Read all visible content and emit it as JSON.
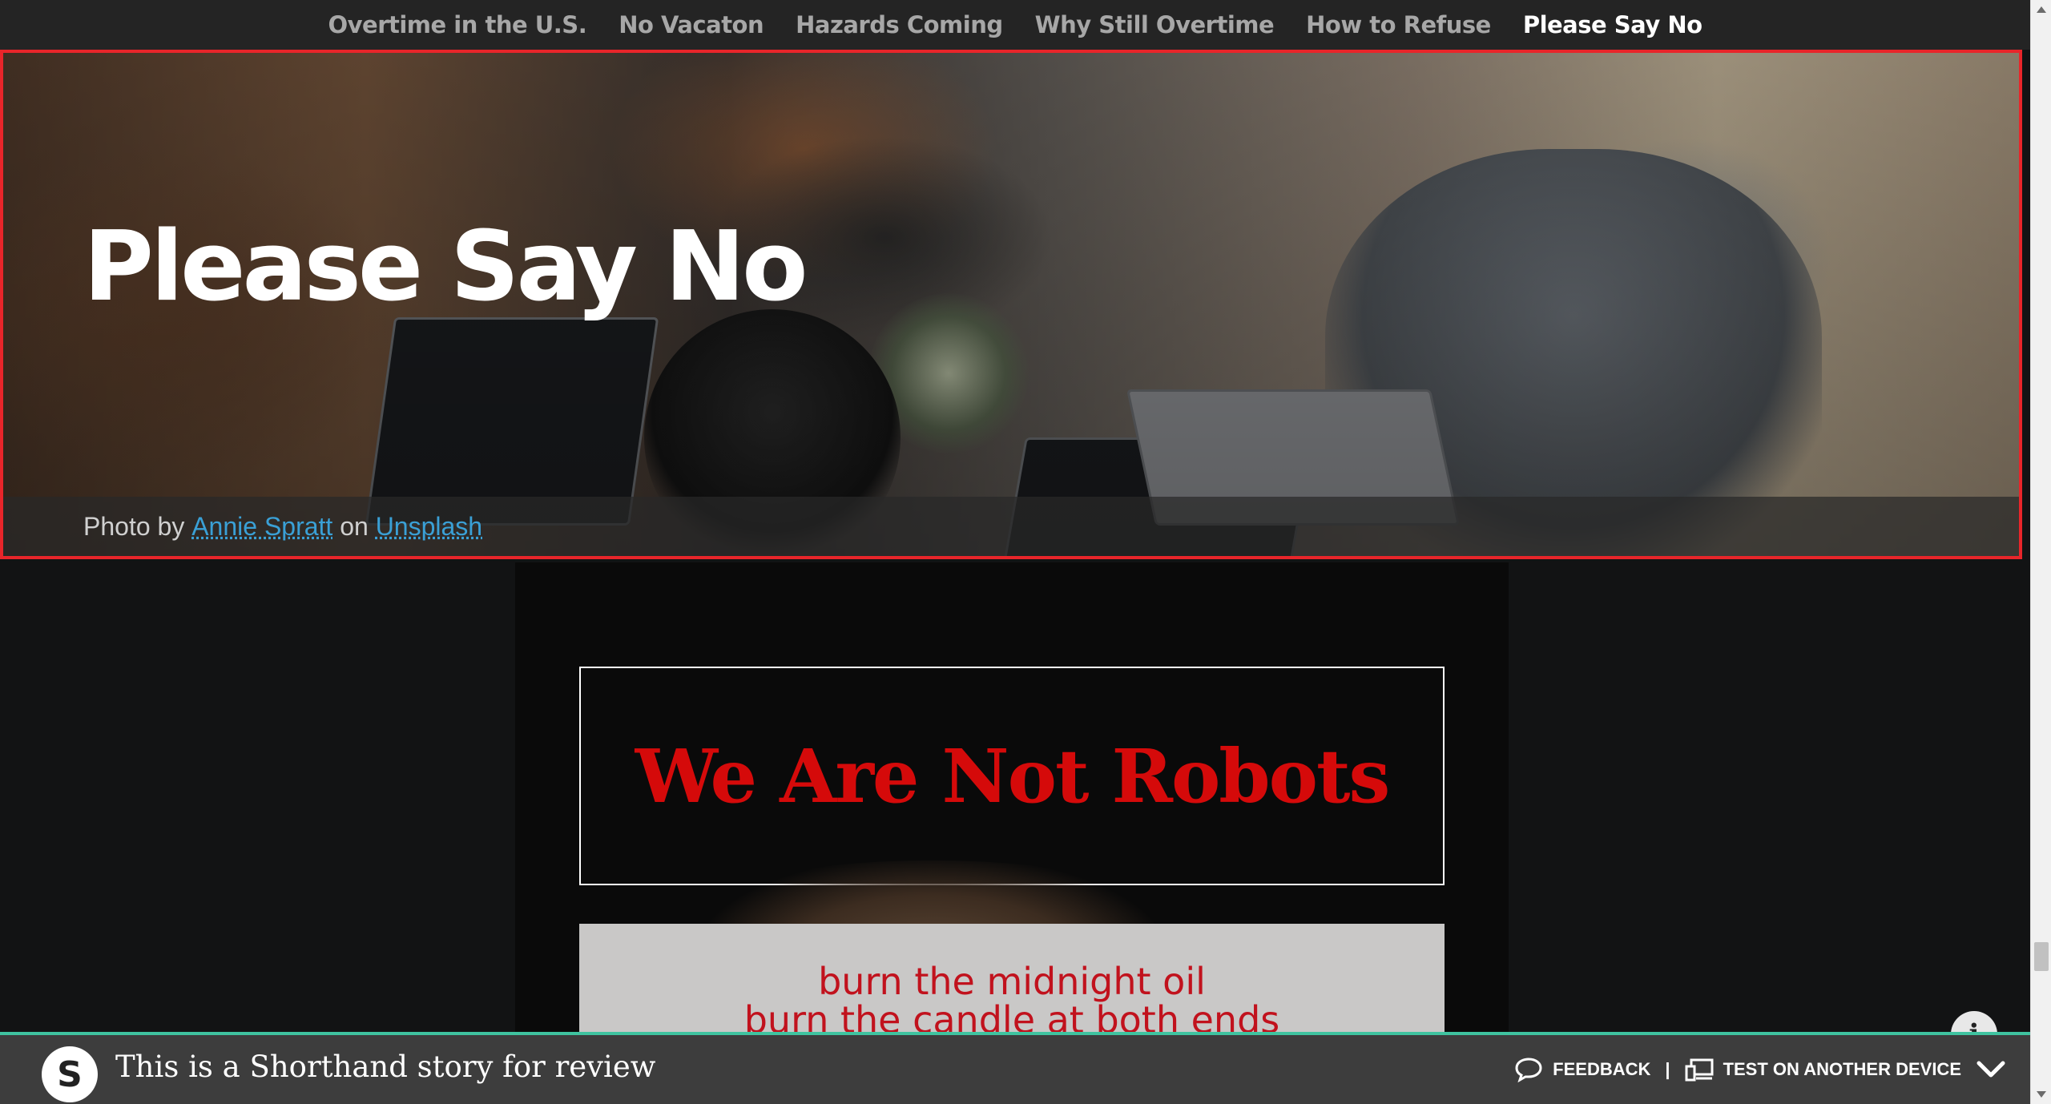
{
  "nav": {
    "items": [
      {
        "label": "Overtime in the U.S.",
        "active": false
      },
      {
        "label": "No Vacaton",
        "active": false
      },
      {
        "label": "Hazards Coming",
        "active": false
      },
      {
        "label": "Why Still Overtime",
        "active": false
      },
      {
        "label": "How to Refuse",
        "active": false
      },
      {
        "label": "Please Say No",
        "active": true
      }
    ]
  },
  "hero": {
    "title": "Please Say No",
    "credit": {
      "prefix": "Photo by",
      "author": "Annie Spratt",
      "middle": "on",
      "source": "Unsplash"
    }
  },
  "section": {
    "headline": "We Are Not Robots",
    "poem_lines": [
      "burn the midnight oil",
      "burn the candle at both ends"
    ]
  },
  "info_button": {
    "glyph": "i"
  },
  "review_bar": {
    "logo_letter": "S",
    "text": "This is a Shorthand story for review",
    "feedback_label": "FEEDBACK",
    "separator": "|",
    "test_device_label": "TEST ON ANOTHER DEVICE"
  },
  "colors": {
    "headline_red": "#d50a0a",
    "link_blue": "#3aa0d6",
    "review_accent": "#3fc3a0",
    "hero_border": "#e8252a"
  }
}
